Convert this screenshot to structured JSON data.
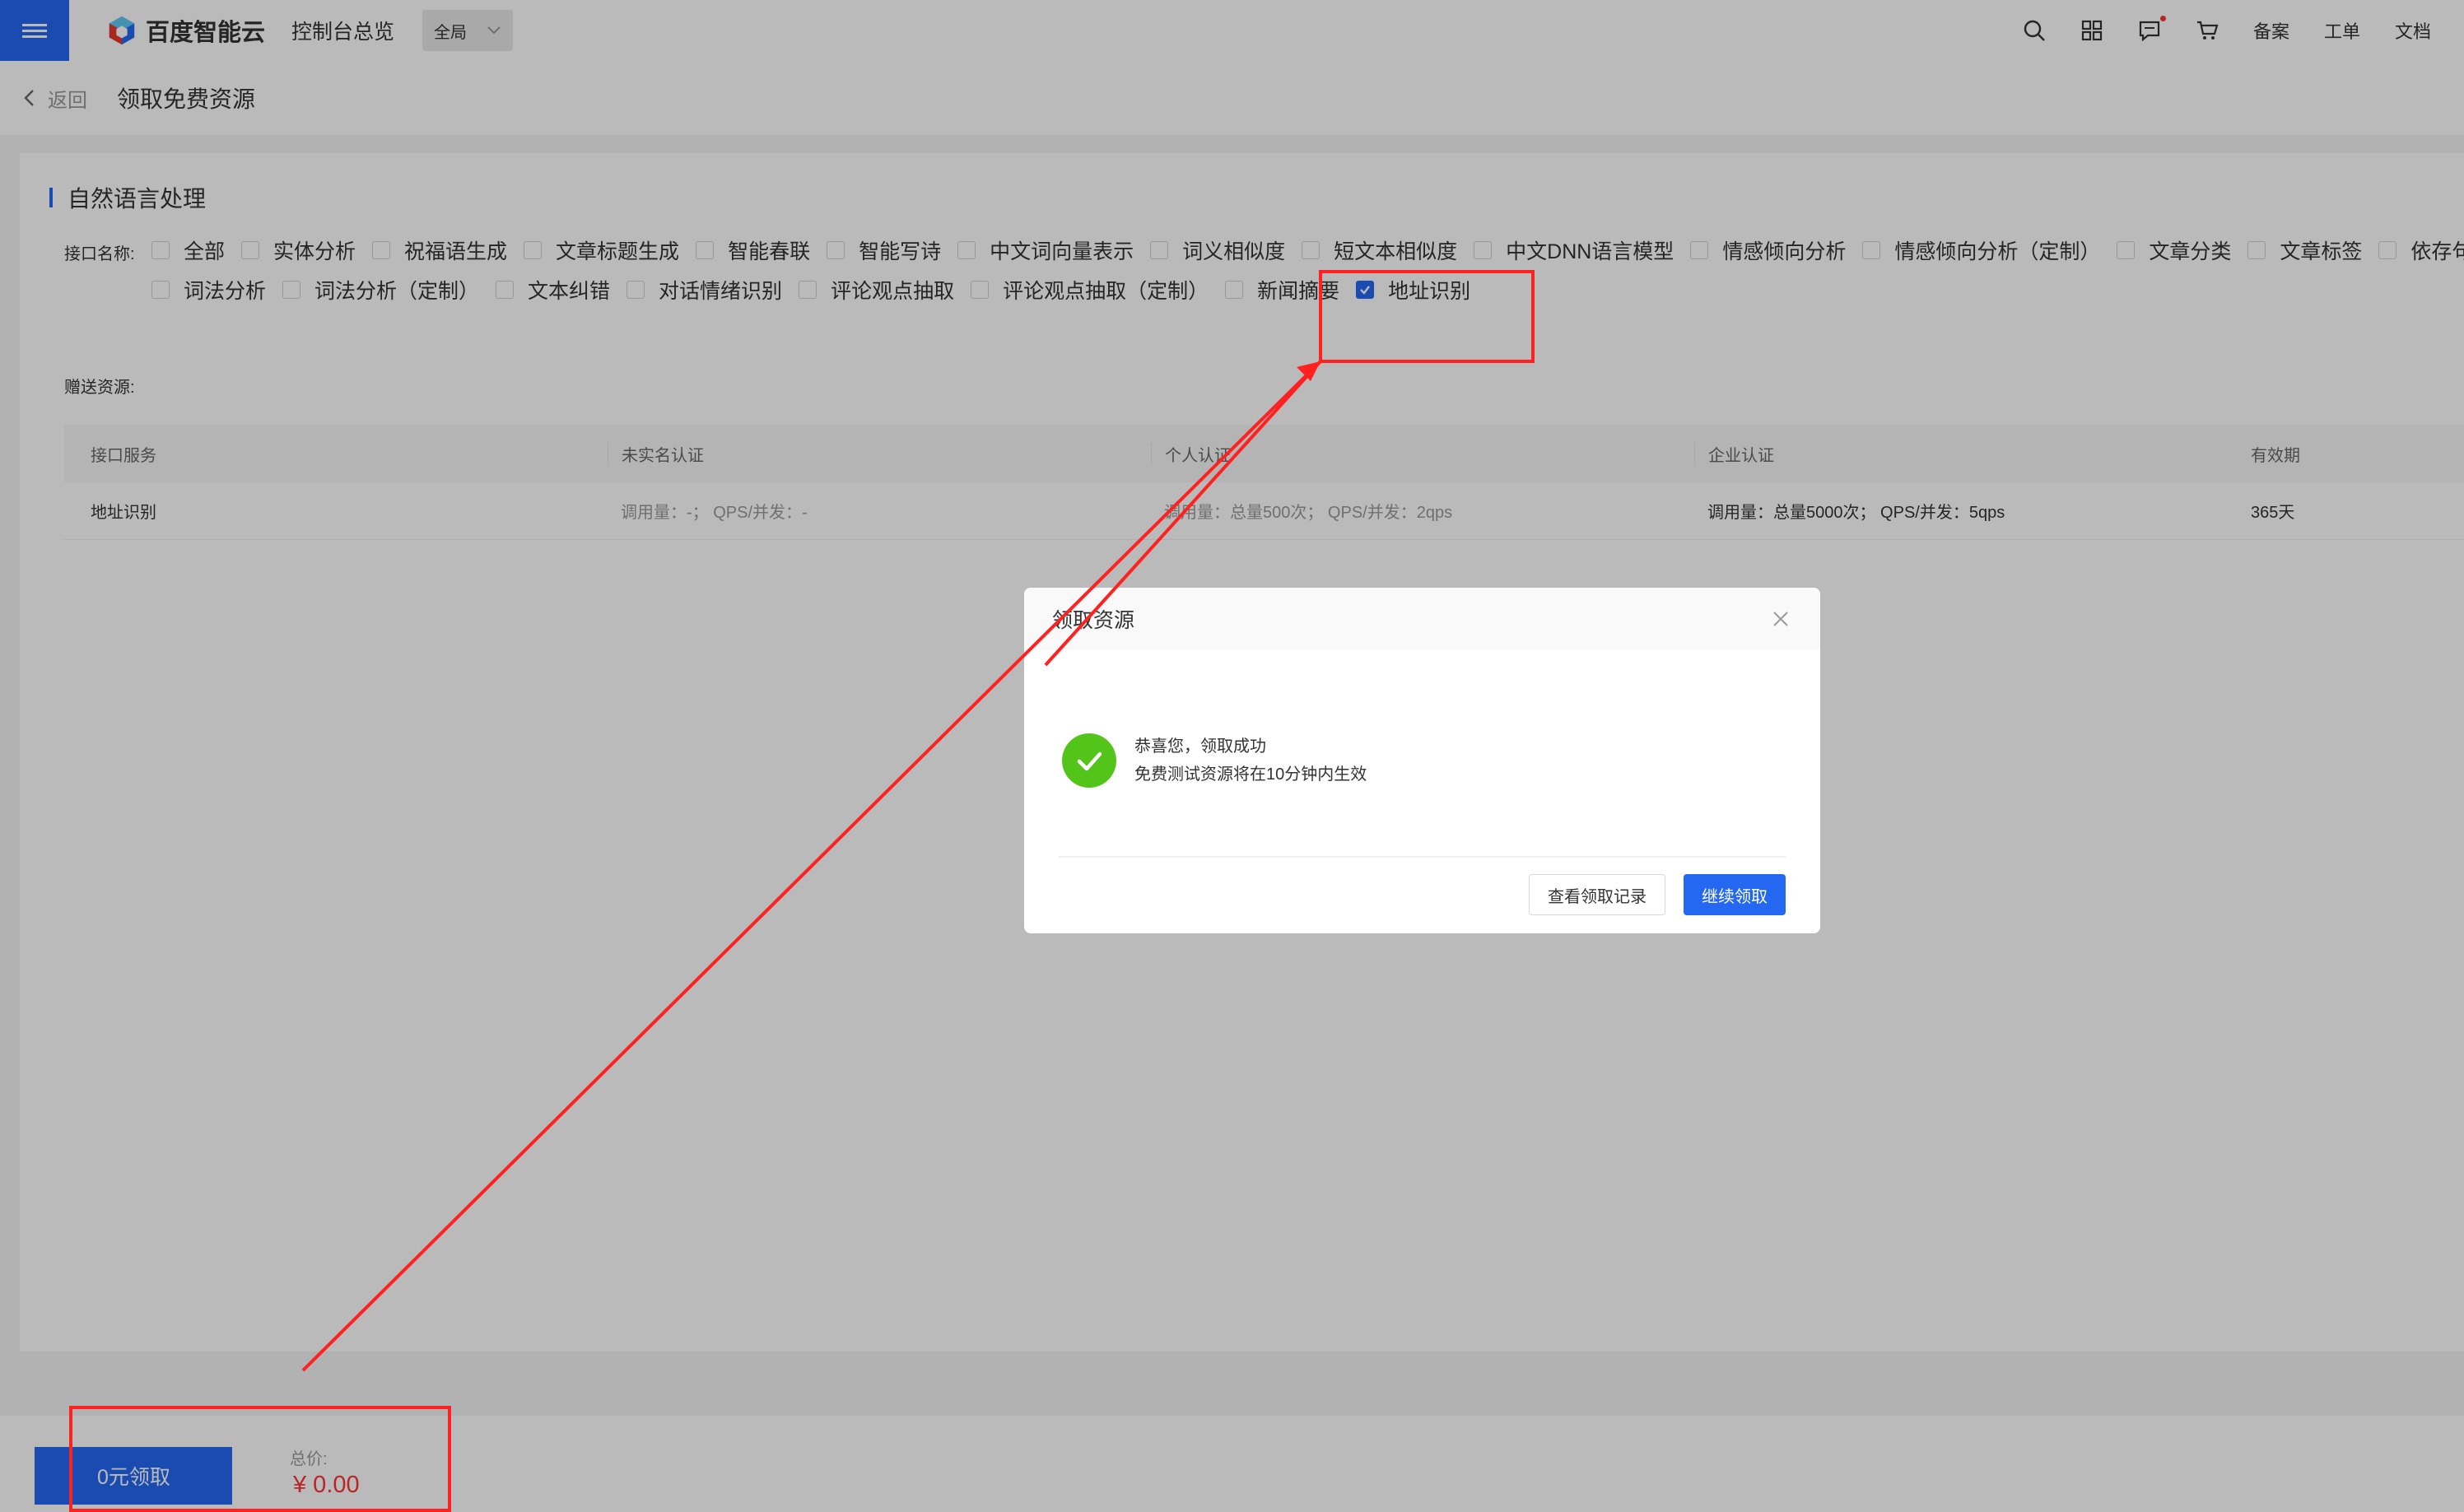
{
  "topbar": {
    "brand": "百度智能云",
    "console_link": "控制台总览",
    "region": "全局",
    "links": [
      "备案",
      "工单",
      "文档"
    ]
  },
  "subbar": {
    "back": "返回",
    "title": "领取免费资源"
  },
  "section": {
    "title": "自然语言处理",
    "interface_label": "接口名称:",
    "interfaces_row1": [
      {
        "label": "全部",
        "checked": false
      },
      {
        "label": "实体分析",
        "checked": false
      },
      {
        "label": "祝福语生成",
        "checked": false
      },
      {
        "label": "文章标题生成",
        "checked": false
      },
      {
        "label": "智能春联",
        "checked": false
      },
      {
        "label": "智能写诗",
        "checked": false
      },
      {
        "label": "中文词向量表示",
        "checked": false
      },
      {
        "label": "词义相似度",
        "checked": false
      },
      {
        "label": "短文本相似度",
        "checked": false
      },
      {
        "label": "中文DNN语言模型",
        "checked": false
      },
      {
        "label": "情感倾向分析",
        "checked": false
      },
      {
        "label": "情感倾向分析（定制）",
        "checked": false
      },
      {
        "label": "文章分类",
        "checked": false
      },
      {
        "label": "文章标签",
        "checked": false
      },
      {
        "label": "依存句法分",
        "checked": false
      }
    ],
    "interfaces_row2": [
      {
        "label": "词法分析",
        "checked": false
      },
      {
        "label": "词法分析（定制）",
        "checked": false
      },
      {
        "label": "文本纠错",
        "checked": false
      },
      {
        "label": "对话情绪识别",
        "checked": false
      },
      {
        "label": "评论观点抽取",
        "checked": false
      },
      {
        "label": "评论观点抽取（定制）",
        "checked": false
      },
      {
        "label": "新闻摘要",
        "checked": false
      },
      {
        "label": "地址识别",
        "checked": true
      }
    ],
    "gift_label": "赠送资源:"
  },
  "table": {
    "headers": [
      "接口服务",
      "未实名认证",
      "个人认证",
      "企业认证",
      "有效期"
    ],
    "rows": [
      [
        "地址识别",
        "调用量：-； QPS/并发：-",
        "调用量：总量500次； QPS/并发：2qps",
        "调用量：总量5000次； QPS/并发：5qps",
        "365天"
      ]
    ]
  },
  "footer": {
    "claim_button": "0元领取",
    "total_label": "总价:",
    "total_value": "¥ 0.00"
  },
  "modal": {
    "title": "领取资源",
    "message_line1": "恭喜您，领取成功",
    "message_line2": "免费测试资源将在10分钟内生效",
    "btn_records": "查看领取记录",
    "btn_continue": "继续领取"
  },
  "colors": {
    "primary": "#2468f2",
    "success": "#52c41a",
    "price": "#ff3333",
    "annotation": "#ff2020"
  }
}
